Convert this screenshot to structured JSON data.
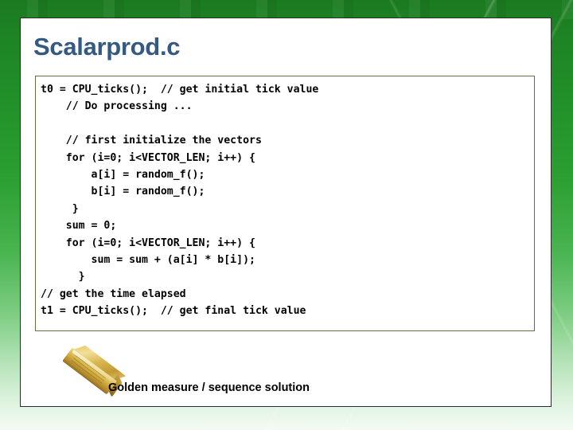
{
  "slide": {
    "title": "Scalarprod.c",
    "title_color": "#355a82",
    "frame_color_top": "#1b7a20",
    "frame_color_bottom": "#f4fbf4",
    "panel_background": "#ffffff"
  },
  "code_block": {
    "border_color": "#6b6b3f",
    "background": "#ffffff",
    "text_color": "#000000",
    "lines": [
      "t0 = CPU_ticks();  // get initial tick value",
      "    // Do processing ...",
      "",
      "    // first initialize the vectors",
      "    for (i=0; i<VECTOR_LEN; i++) {",
      "        a[i] = random_f();",
      "        b[i] = random_f();",
      "     }",
      "    sum = 0;",
      "    for (i=0; i<VECTOR_LEN; i++) {",
      "        sum = sum + (a[i] * b[i]);",
      "      }",
      "// get the time elapsed",
      "t1 = CPU_ticks();  // get final tick value"
    ],
    "full_text": "t0 = CPU_ticks();  // get initial tick value\n    // Do processing ...\n\n    // first initialize the vectors\n    for (i=0; i<VECTOR_LEN; i++) {\n        a[i] = random_f();\n        b[i] = random_f();\n     }\n    sum = 0;\n    for (i=0; i<VECTOR_LEN; i++) {\n        sum = sum + (a[i] * b[i]);\n      }\n// get the time elapsed\nt1 = CPU_ticks();  // get final tick value"
  },
  "footnote": {
    "icon": "gold-bar-icon",
    "caption": "Golden measure / sequence solution",
    "caption_color": "#000000"
  }
}
